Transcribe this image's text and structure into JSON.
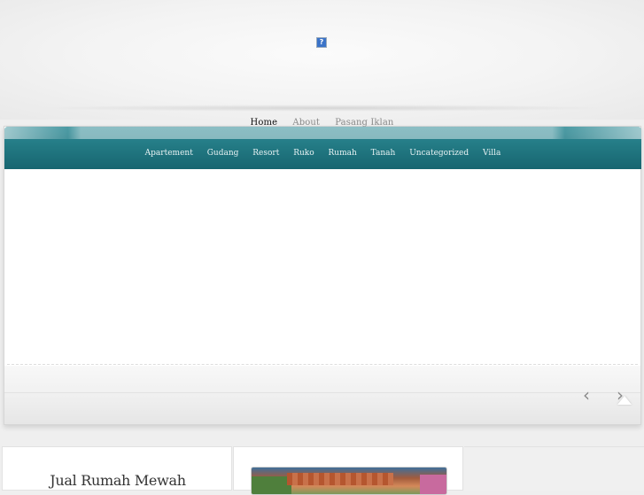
{
  "header": {
    "logo_icon": "broken-image-icon",
    "logo_glyph": "?"
  },
  "top_nav": {
    "items": [
      {
        "label": "Home",
        "active": true
      },
      {
        "label": "About",
        "active": false
      },
      {
        "label": "Pasang Iklan",
        "active": false
      }
    ]
  },
  "category_nav": {
    "items": [
      "Apartement",
      "Gudang",
      "Resort",
      "Ruko",
      "Rumah",
      "Tanah",
      "Uncategorized",
      "Villa"
    ]
  },
  "slider": {
    "prev_icon": "chevron-left-icon",
    "next_icon": "chevron-right-icon",
    "prev_glyph": "‹",
    "next_glyph": "›",
    "scroll_top_icon": "arrow-up-icon"
  },
  "posts": [
    {
      "title": "Jual Rumah Mewah"
    }
  ],
  "colors": {
    "nav_bar": "#237a84",
    "page_bg": "#efefef"
  }
}
